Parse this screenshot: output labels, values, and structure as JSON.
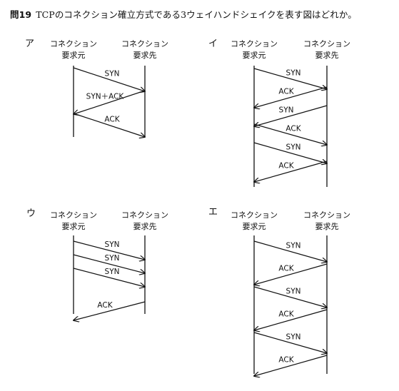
{
  "question": {
    "number": "問19",
    "text": "TCPのコネクション確立方式である3ウェイハンドシェイクを表す図はどれか。"
  },
  "options": [
    {
      "label": "ア",
      "left_endpoint": [
        "コネクション",
        "要求元"
      ],
      "right_endpoint": [
        "コネクション",
        "要求先"
      ],
      "messages": [
        {
          "text": "SYN",
          "direction": "left-to-right"
        },
        {
          "text": "SYN＋ACK",
          "direction": "right-to-left"
        },
        {
          "text": "ACK",
          "direction": "left-to-right"
        }
      ]
    },
    {
      "label": "イ",
      "left_endpoint": [
        "コネクション",
        "要求元"
      ],
      "right_endpoint": [
        "コネクション",
        "要求先"
      ],
      "messages": [
        {
          "text": "SYN",
          "direction": "left-to-right"
        },
        {
          "text": "ACK",
          "direction": "right-to-left"
        },
        {
          "text": "SYN",
          "direction": "right-to-left"
        },
        {
          "text": "ACK",
          "direction": "left-to-right"
        },
        {
          "text": "SYN",
          "direction": "left-to-right"
        },
        {
          "text": "ACK",
          "direction": "right-to-left"
        }
      ]
    },
    {
      "label": "ウ",
      "left_endpoint": [
        "コネクション",
        "要求元"
      ],
      "right_endpoint": [
        "コネクション",
        "要求先"
      ],
      "messages": [
        {
          "text": "SYN",
          "direction": "left-to-right"
        },
        {
          "text": "SYN",
          "direction": "left-to-right"
        },
        {
          "text": "SYN",
          "direction": "left-to-right"
        },
        {
          "text": "ACK",
          "direction": "right-to-left"
        }
      ]
    },
    {
      "label": "エ",
      "left_endpoint": [
        "コネクション",
        "要求元"
      ],
      "right_endpoint": [
        "コネクション",
        "要求先"
      ],
      "messages": [
        {
          "text": "SYN",
          "direction": "left-to-right"
        },
        {
          "text": "ACK",
          "direction": "right-to-left"
        },
        {
          "text": "SYN",
          "direction": "left-to-right"
        },
        {
          "text": "ACK",
          "direction": "right-to-left"
        },
        {
          "text": "SYN",
          "direction": "left-to-right"
        },
        {
          "text": "ACK",
          "direction": "right-to-left"
        }
      ]
    }
  ]
}
